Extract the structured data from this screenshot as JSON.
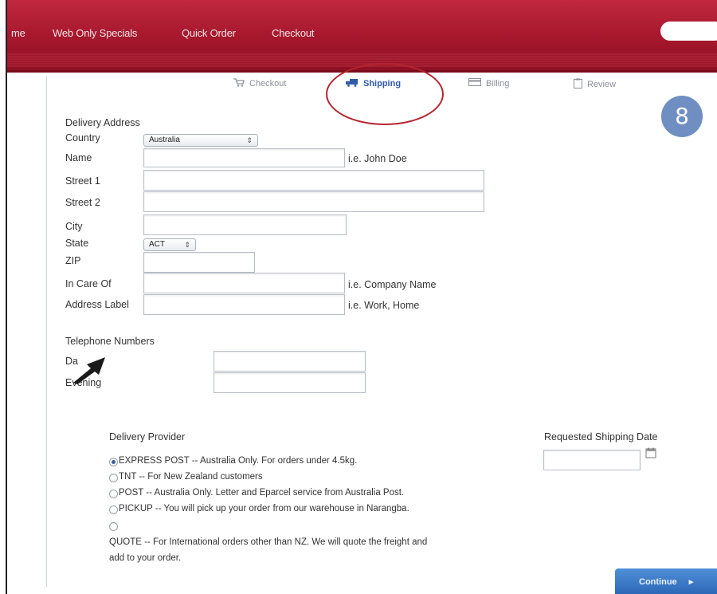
{
  "nav": {
    "items": [
      {
        "label": "me"
      },
      {
        "label": "Web Only Specials"
      },
      {
        "label": "Quick Order"
      },
      {
        "label": "Checkout"
      }
    ]
  },
  "steps": [
    {
      "label": "Checkout",
      "icon": "cart-icon"
    },
    {
      "label": "Shipping",
      "icon": "truck-icon",
      "active": true
    },
    {
      "label": "Billing",
      "icon": "card-icon"
    },
    {
      "label": "Review",
      "icon": "clipboard-icon"
    }
  ],
  "badge": "8",
  "delivery_address": {
    "heading": "Delivery Address",
    "country_label": "Country",
    "country_value": "Australia",
    "name_label": "Name",
    "name_hint": "i.e. John Doe",
    "street1_label": "Street 1",
    "street2_label": "Street 2",
    "city_label": "City",
    "state_label": "State",
    "state_value": "ACT",
    "zip_label": "ZIP",
    "in_care_of_label": "In Care Of",
    "in_care_of_hint": "i.e. Company Name",
    "address_label_label": "Address Label",
    "address_label_hint": "i.e. Work, Home"
  },
  "telephone": {
    "heading": "Telephone Numbers",
    "day_label": "Da",
    "evening_label": "Evening"
  },
  "delivery_provider": {
    "heading": "Delivery Provider",
    "options": [
      {
        "text": "EXPRESS POST -- Australia Only. For orders under 4.5kg.",
        "checked": true
      },
      {
        "text": "TNT -- For New Zealand customers",
        "checked": false
      },
      {
        "text": "POST -- Australia Only. Letter and Eparcel service from Australia Post.",
        "checked": false
      },
      {
        "text": "PICKUP -- You will pick up your order from our warehouse in Narangba.",
        "checked": false
      },
      {
        "text": "",
        "checked": false
      }
    ],
    "quote_line1": "QUOTE -- For International orders other than NZ. We will quote the freight and",
    "quote_line2": "add to your order."
  },
  "shipping_date": {
    "label": "Requested Shipping Date"
  },
  "continue_label": "Continue"
}
